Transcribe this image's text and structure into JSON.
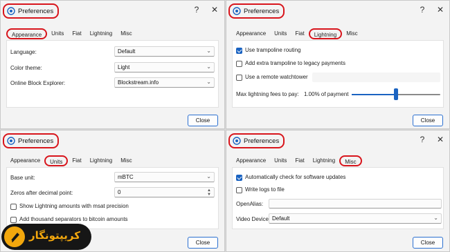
{
  "windows": {
    "appearance": {
      "title": "Preferences",
      "help": "?",
      "close_x": "✕",
      "tabs": [
        "Appearance",
        "Units",
        "Fiat",
        "Lightning",
        "Misc"
      ],
      "active_tab": "Appearance",
      "fields": [
        {
          "label": "Language:",
          "value": "Default"
        },
        {
          "label": "Color theme:",
          "value": "Light"
        },
        {
          "label": "Online Block Explorer:",
          "value": "Blockstream.info"
        }
      ],
      "close_label": "Close"
    },
    "lightning": {
      "title": "Preferences",
      "help": "?",
      "close_x": "✕",
      "tabs": [
        "Appearance",
        "Units",
        "Fiat",
        "Lightning",
        "Misc"
      ],
      "active_tab": "Lightning",
      "checkboxes": [
        {
          "label": "Use trampoline routing",
          "checked": true
        },
        {
          "label": "Add extra trampoline to legacy payments",
          "checked": false
        },
        {
          "label": "Use a remote watchtower",
          "checked": false
        }
      ],
      "fee_label": "Max lightning fees to pay:",
      "fee_value": "1.00% of payment",
      "fee_slider_level": 0.5,
      "close_label": "Close"
    },
    "units": {
      "title": "Preferences",
      "help": "?",
      "close_x": "✕",
      "tabs": [
        "Appearance",
        "Units",
        "Fiat",
        "Lightning",
        "Misc"
      ],
      "active_tab": "Units",
      "base_unit_label": "Base unit:",
      "base_unit_value": "mBTC",
      "zeros_label": "Zeros after decimal point:",
      "zeros_value": "0",
      "checkboxes": [
        {
          "label": "Show Lightning amounts with msat precision",
          "checked": false
        },
        {
          "label": "Add thousand separators to bitcoin amounts",
          "checked": false
        }
      ],
      "close_label": "Close"
    },
    "misc": {
      "title": "Preferences",
      "help": "?",
      "close_x": "✕",
      "tabs": [
        "Appearance",
        "Units",
        "Fiat",
        "Lightning",
        "Misc"
      ],
      "active_tab": "Misc",
      "checkboxes": [
        {
          "label": "Automatically check for software updates",
          "checked": true
        },
        {
          "label": "Write logs to file",
          "checked": false
        }
      ],
      "openalias_label": "OpenAlias:",
      "openalias_value": "",
      "video_label": "Video Device:",
      "video_value": "Default",
      "close_label": "Close"
    }
  },
  "watermark": {
    "text": "کریپتونگار",
    "color": "#f2a70d"
  },
  "colors": {
    "highlight": "#d8141b",
    "accent": "#1a63c1"
  }
}
